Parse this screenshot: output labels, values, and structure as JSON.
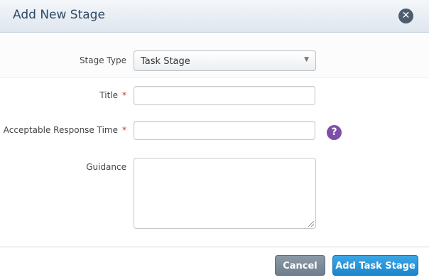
{
  "dialog": {
    "title": "Add New Stage",
    "close_icon": "close-icon"
  },
  "form": {
    "stage_type": {
      "label": "Stage Type",
      "value": "Task Stage"
    },
    "title": {
      "label": "Title",
      "required_mark": "*",
      "value": "",
      "placeholder": ""
    },
    "response_time": {
      "label": "Acceptable Response Time",
      "required_mark": "*",
      "value": "",
      "placeholder": "",
      "help_icon": "question-mark-icon",
      "help_glyph": "?"
    },
    "guidance": {
      "label": "Guidance",
      "value": ""
    }
  },
  "footer": {
    "cancel_label": "Cancel",
    "submit_label": "Add Task Stage"
  },
  "colors": {
    "header_title": "#2e4a66",
    "required": "#cc2b2b",
    "help": "#7d4fa8",
    "primary": "#1b85cc",
    "cancel": "#6f7e8d"
  }
}
